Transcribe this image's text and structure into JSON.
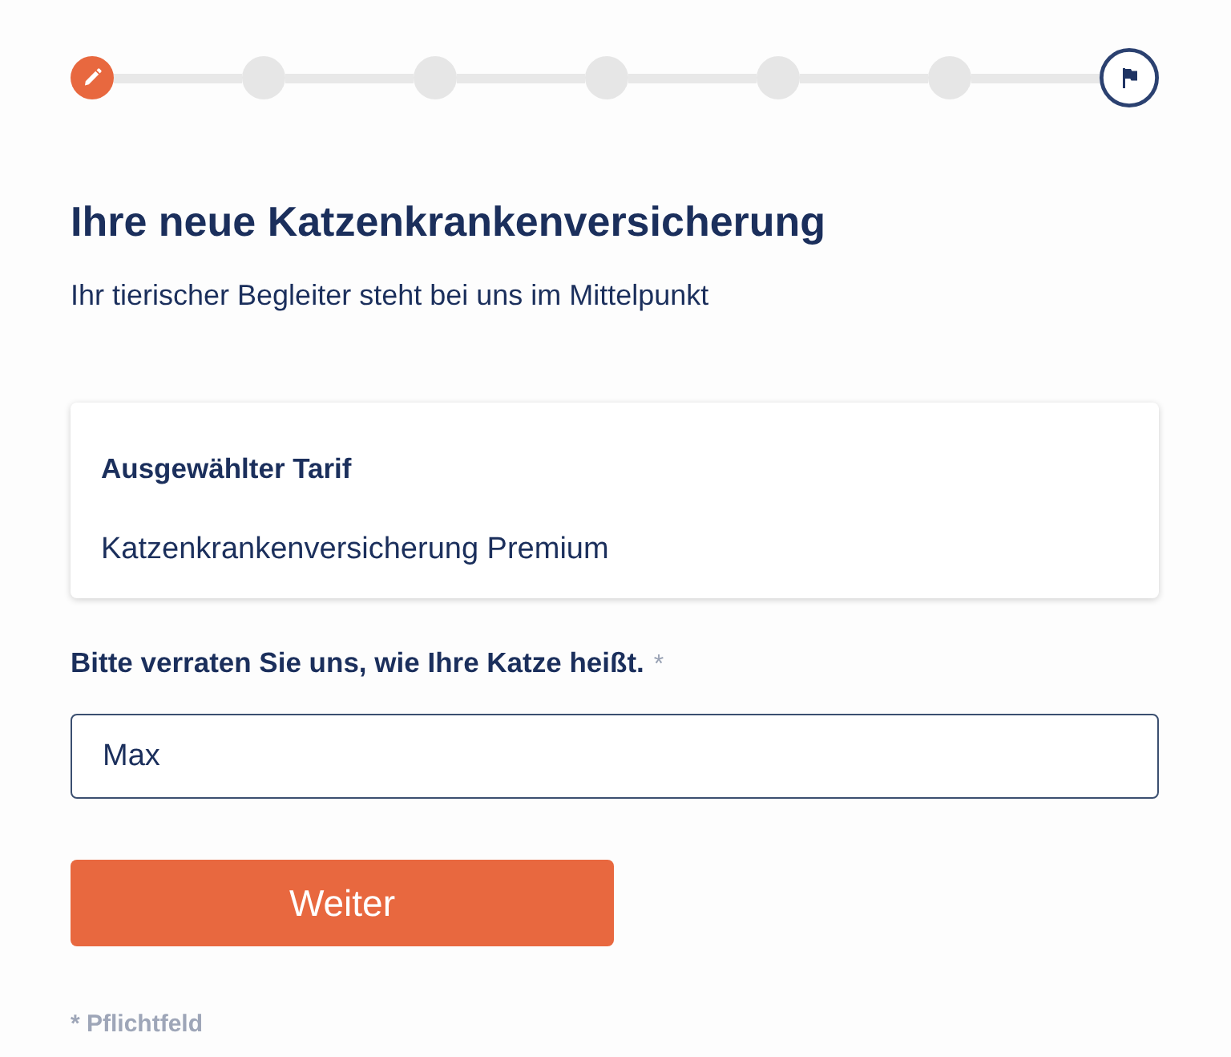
{
  "stepper": {
    "steps": [
      {
        "kind": "current"
      },
      {
        "kind": "pending"
      },
      {
        "kind": "pending"
      },
      {
        "kind": "pending"
      },
      {
        "kind": "pending"
      },
      {
        "kind": "pending"
      },
      {
        "kind": "final"
      }
    ]
  },
  "heading": {
    "title": "Ihre neue Katzenkrankenversicherung",
    "subtitle": "Ihr tierischer Begleiter steht bei uns im Mittelpunkt"
  },
  "tariff_card": {
    "label": "Ausgewählter Tarif",
    "value": "Katzenkrankenversicherung Premium"
  },
  "name_field": {
    "label": "Bitte verraten Sie uns, wie Ihre Katze heißt.",
    "required_mark": "*",
    "value": "Max"
  },
  "buttons": [
    {
      "label": "Weiter"
    }
  ],
  "footnote": "* Pflichtfeld"
}
